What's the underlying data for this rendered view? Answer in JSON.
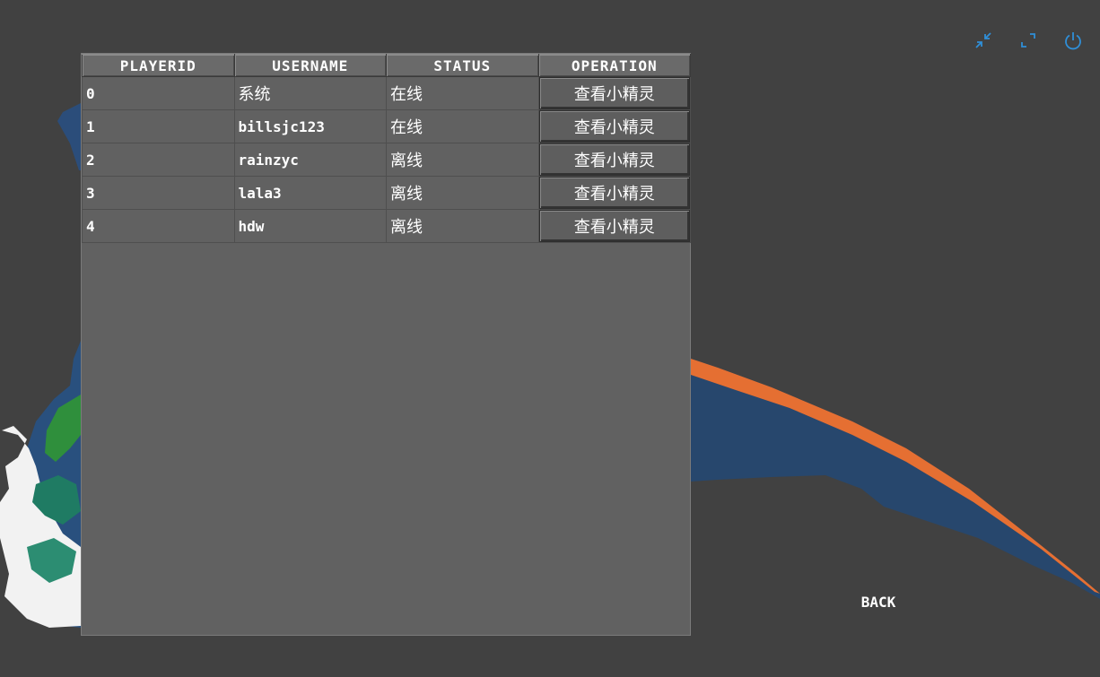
{
  "colors": {
    "background": "#414141",
    "panel": "#616161",
    "icon_accent": "#2f8fd8",
    "text": "#ffffff"
  },
  "window_controls": [
    {
      "icon": "minimize-icon"
    },
    {
      "icon": "maximize-icon"
    },
    {
      "icon": "power-icon"
    }
  ],
  "table": {
    "headers": [
      "PLAYERID",
      "USERNAME",
      "STATUS",
      "OPERATION"
    ],
    "rows": [
      {
        "id": "0",
        "username": "系统",
        "status": "在线",
        "operation": "查看小精灵"
      },
      {
        "id": "1",
        "username": "billsjc123",
        "status": "在线",
        "operation": "查看小精灵"
      },
      {
        "id": "2",
        "username": "rainzyc",
        "status": "离线",
        "operation": "查看小精灵"
      },
      {
        "id": "3",
        "username": "lala3",
        "status": "离线",
        "operation": "查看小精灵"
      },
      {
        "id": "4",
        "username": "hdw",
        "status": "离线",
        "operation": "查看小精灵"
      }
    ]
  },
  "back_label": "BACK"
}
